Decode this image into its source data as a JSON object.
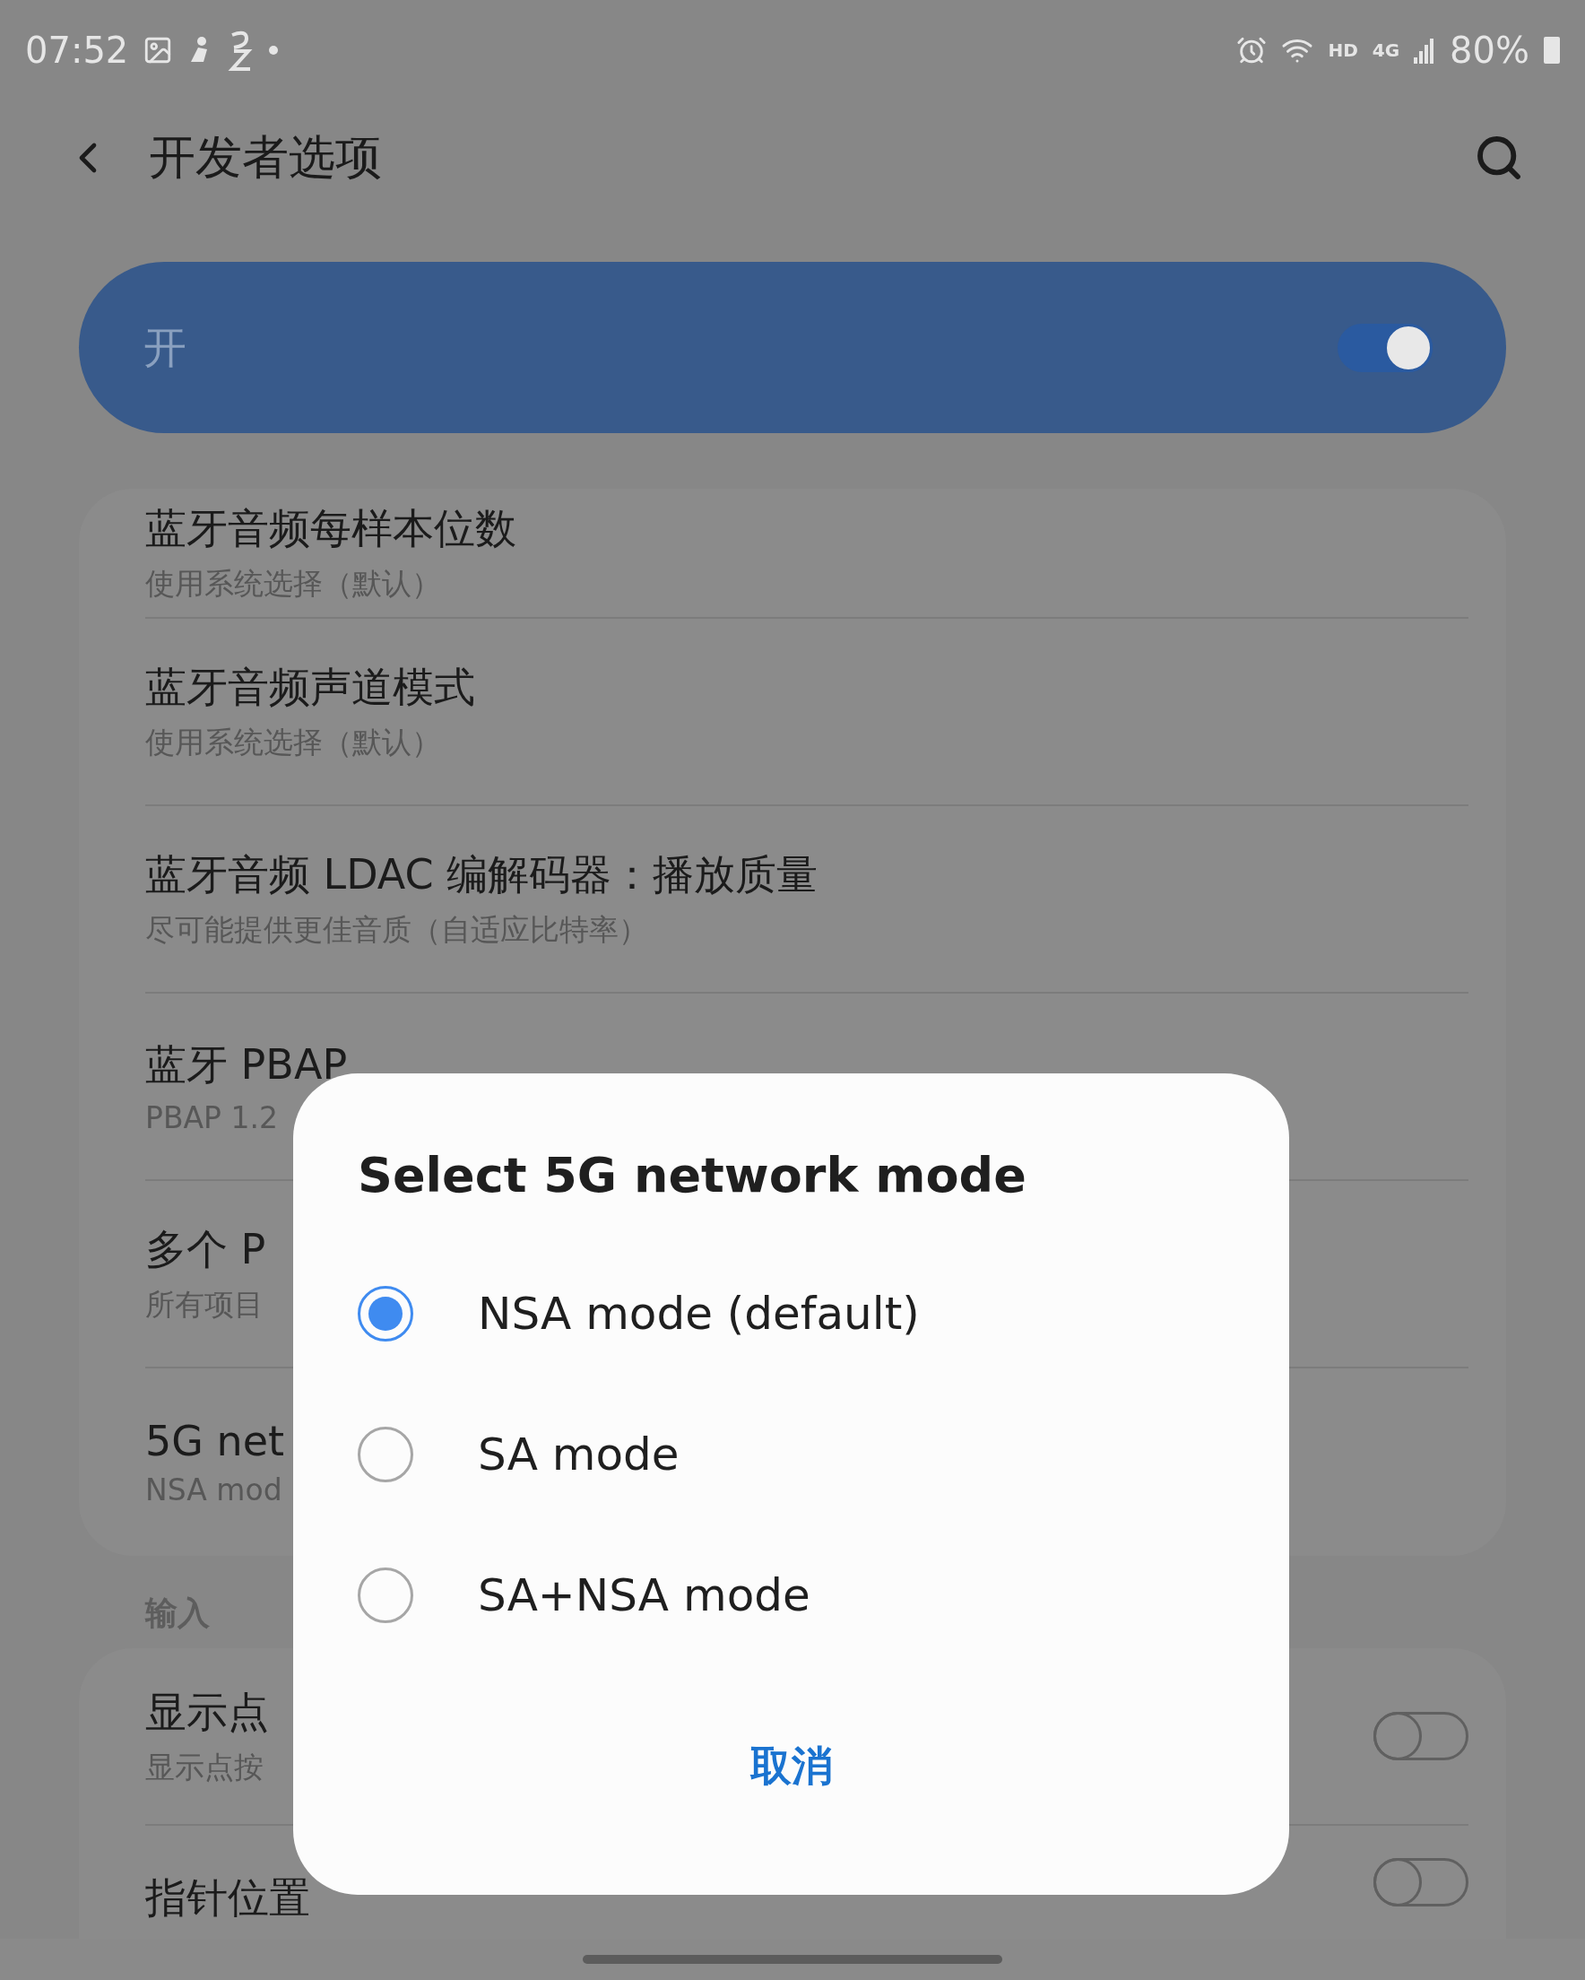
{
  "status_bar": {
    "time": "07:52",
    "network": "HD",
    "signal": "4G",
    "battery": "80%"
  },
  "header": {
    "title": "开发者选项"
  },
  "master_switch": {
    "label": "开",
    "on": true
  },
  "sections": [
    {
      "items": [
        {
          "title": "蓝牙音频每样本位数",
          "subtitle": "使用系统选择（默认）"
        },
        {
          "title": "蓝牙音频声道模式",
          "subtitle": "使用系统选择（默认）"
        },
        {
          "title": "蓝牙音频 LDAC 编解码器：播放质量",
          "subtitle": "尽可能提供更佳音质（自适应比特率）"
        },
        {
          "title": "蓝牙 PBAP",
          "subtitle": "PBAP 1.2"
        },
        {
          "title": "多个 P",
          "subtitle": "所有项目"
        },
        {
          "title": "5G net",
          "subtitle": "NSA mod"
        }
      ]
    },
    {
      "header": "输入",
      "items": [
        {
          "title": "显示点",
          "subtitle": "显示点按",
          "switch_on": false
        },
        {
          "title": "指针位置",
          "switch_on": false
        }
      ]
    }
  ],
  "dialog": {
    "title": "Select 5G network mode",
    "options": [
      {
        "label": "NSA mode (default)",
        "selected": true
      },
      {
        "label": "SA mode",
        "selected": false
      },
      {
        "label": "SA+NSA mode",
        "selected": false
      }
    ],
    "cancel": "取消"
  }
}
